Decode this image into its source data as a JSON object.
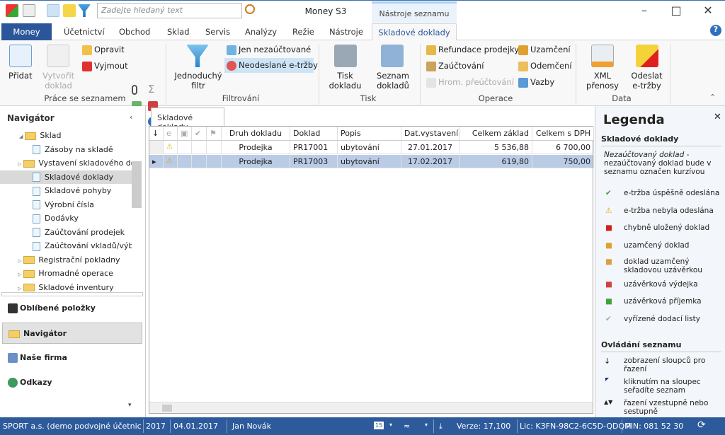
{
  "app": {
    "title": "Money S3",
    "context_header": "Nástroje seznamu",
    "search_placeholder": "Zadejte hledaný text"
  },
  "tabs": [
    {
      "label": "Money"
    },
    {
      "label": "Účetnictví"
    },
    {
      "label": "Obchod"
    },
    {
      "label": "Sklad"
    },
    {
      "label": "Servis"
    },
    {
      "label": "Analýzy"
    },
    {
      "label": "Režie"
    },
    {
      "label": "Nástroje"
    },
    {
      "label": "Skladové doklady",
      "active": true
    }
  ],
  "ribbon": {
    "prace": {
      "label": "Práce se seznamem",
      "pridat": "Přidat",
      "vytvorit": "Vytvořit doklad",
      "opravit": "Opravit",
      "vyjmout": "Vyjmout"
    },
    "filtr": {
      "label": "Filtrování",
      "jednoduchy": "Jednoduchý filtr",
      "jen": "Jen nezaúčtované",
      "neodeslane": "Neodeslané e-tržby"
    },
    "tisk": {
      "label": "Tisk",
      "tisk_dokladu": "Tisk dokladu",
      "seznam": "Seznam dokladů"
    },
    "operace": {
      "label": "Operace",
      "refundace": "Refundace prodejky",
      "zauctovani": "Zaúčtování",
      "hrom": "Hrom. přeúčtování",
      "uzamceni": "Uzamčení",
      "odemceni": "Odemčení",
      "vazby": "Vazby"
    },
    "data": {
      "label": "Data",
      "xml": "XML přenosy",
      "odeslat": "Odeslat e-tržby"
    }
  },
  "navigator": {
    "title": "Navigátor",
    "tree": [
      {
        "label": "Sklad",
        "type": "folder",
        "level": 0
      },
      {
        "label": "Zásoby na skladě",
        "type": "doc",
        "level": 1
      },
      {
        "label": "Vystavení skladového dokladu",
        "type": "folder",
        "level": 1
      },
      {
        "label": "Skladové doklady",
        "type": "doc",
        "level": 1,
        "selected": true
      },
      {
        "label": "Skladové pohyby",
        "type": "doc",
        "level": 1
      },
      {
        "label": "Výrobní čísla",
        "type": "doc",
        "level": 1
      },
      {
        "label": "Dodávky",
        "type": "doc",
        "level": 1
      },
      {
        "label": "Zaúčtování prodejek",
        "type": "doc",
        "level": 1
      },
      {
        "label": "Zaúčtování vkladů/výběrů",
        "type": "doc",
        "level": 1
      },
      {
        "label": "Registrační pokladny",
        "type": "folder",
        "level": 1
      },
      {
        "label": "Hromadné operace",
        "type": "folder",
        "level": 1
      },
      {
        "label": "Skladové inventury",
        "type": "folder",
        "level": 1
      }
    ],
    "buttons": [
      {
        "label": "Oblíbené položky"
      },
      {
        "label": "Navigátor",
        "selected": true
      },
      {
        "label": "Naše firma"
      },
      {
        "label": "Odkazy"
      }
    ]
  },
  "list": {
    "tab": "Skladové doklady",
    "columns": [
      "Druh dokladu",
      "Doklad",
      "Popis",
      "Dat.vystavení",
      "Celkem základ",
      "Celkem s DPH"
    ],
    "rows": [
      {
        "status": "warning",
        "druh": "Prodejka",
        "doklad": "PR17001",
        "popis": "ubytování",
        "datum": "27.01.2017",
        "zaklad": "5 536,88",
        "dph": "6 700,00"
      },
      {
        "status": "warning",
        "druh": "Prodejka",
        "doklad": "PR17003",
        "popis": "ubytování",
        "datum": "17.02.2017",
        "zaklad": "619,80",
        "dph": "750,00",
        "selected": true
      }
    ]
  },
  "legend": {
    "title": "Legenda",
    "section1": "Skladové doklady",
    "note_em": "Nezaúčtovaný doklad",
    "note": " - nezaúčtovaný doklad bude v seznamu označen kurzívou",
    "items": [
      "e-tržba úspěšně odeslána",
      "e-tržba nebyla odeslána",
      "chybně uložený doklad",
      "uzamčený doklad",
      "doklad uzamčený skladovou uzávěrkou",
      "uzávěrková výdejka",
      "uzávěrková příjemka",
      "vyřízené dodací listy"
    ],
    "section2": "Ovládání seznamu",
    "items2": [
      "zobrazení sloupců pro řazení",
      "kliknutím na sloupec seřadíte seznam",
      "řazení vzestupně nebo sestupně"
    ]
  },
  "status": {
    "company": "SPORT a.s. (demo podvojné účetnictví, s",
    "year": "2017",
    "date": "04.01.2017",
    "user": "Jan Novák",
    "version": "Verze: 17,100",
    "license": "Lic: K3FN-98C2-6C5D-QDQM",
    "pin": "PIN: 081 52 30"
  },
  "colors": {
    "accent": "#2b579a",
    "selected_row": "#b9cbe5",
    "status_bar": "#2d5a9a"
  }
}
